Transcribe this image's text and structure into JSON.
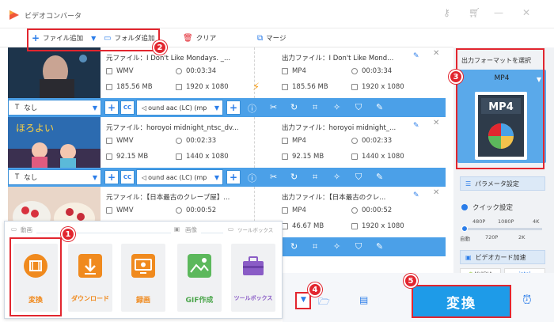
{
  "app": {
    "title": "ビデオコンバータ"
  },
  "toolbar": {
    "add_file": "ファイル追加",
    "add_folder": "フォルダ追加",
    "clear": "クリア",
    "merge": "マージ"
  },
  "files": [
    {
      "src_name": "元ファイル：I Don't Like Mondays. _...",
      "src_format": "WMV",
      "src_duration": "00:03:34",
      "src_size": "185.56 MB",
      "src_resolution": "1920 x 1080",
      "out_name": "出力ファイル：I Don't Like Mond...",
      "out_format": "MP4",
      "out_duration": "00:03:34",
      "out_size": "185.56 MB",
      "out_resolution": "1920 x 1080",
      "subtitle": "なし",
      "audio": "ound aac (LC) (mp"
    },
    {
      "src_name": "元ファイル：horoyoi midnight_ntsc_dv...",
      "src_format": "WMV",
      "src_duration": "00:02:33",
      "src_size": "92.15 MB",
      "src_resolution": "1440 x 1080",
      "out_name": "出力ファイル：horoyoi midnight_...",
      "out_format": "MP4",
      "out_duration": "00:02:33",
      "out_size": "92.15 MB",
      "out_resolution": "1440 x 1080",
      "subtitle": "なし",
      "audio": "ound aac (LC) (mp"
    },
    {
      "src_name": "元ファイル：【日本最古のクレープ屋】...",
      "src_format": "WMV",
      "src_duration": "00:00:52",
      "src_size": "",
      "src_resolution": "",
      "out_name": "出力ファイル：【日本最古のクレ...",
      "out_format": "MP4",
      "out_duration": "00:00:52",
      "out_size": "46.67 MB",
      "out_resolution": "1920 x 1080",
      "subtitle": "",
      "audio": ""
    }
  ],
  "popup": {
    "section_video": "動画",
    "section_image": "画像",
    "section_toolbox": "ツールボックス",
    "tiles": [
      "変換",
      "ダウンロード",
      "録画",
      "GIF作成",
      "ツールボックス"
    ]
  },
  "right_panel": {
    "output_format_title": "出力フォーマットを選択",
    "format": "MP4",
    "format_icon_text": "MP4",
    "param_settings": "パラメータ設定",
    "quick_settings": "クイック設定",
    "slider_top_labels": [
      "480P",
      "1080P",
      "4K"
    ],
    "slider_bottom_labels": [
      "自動",
      "720P",
      "2K"
    ],
    "gpu_accel": "ビデオカード加速",
    "gpu_brands": [
      "NVIDIA",
      "intel"
    ]
  },
  "convert_button": "変換",
  "badges": [
    "1",
    "2",
    "3",
    "4",
    "5"
  ],
  "colors": {
    "accent": "#1e9be8",
    "highlight": "#e2262f",
    "tile_orange": "#f08a1e"
  }
}
